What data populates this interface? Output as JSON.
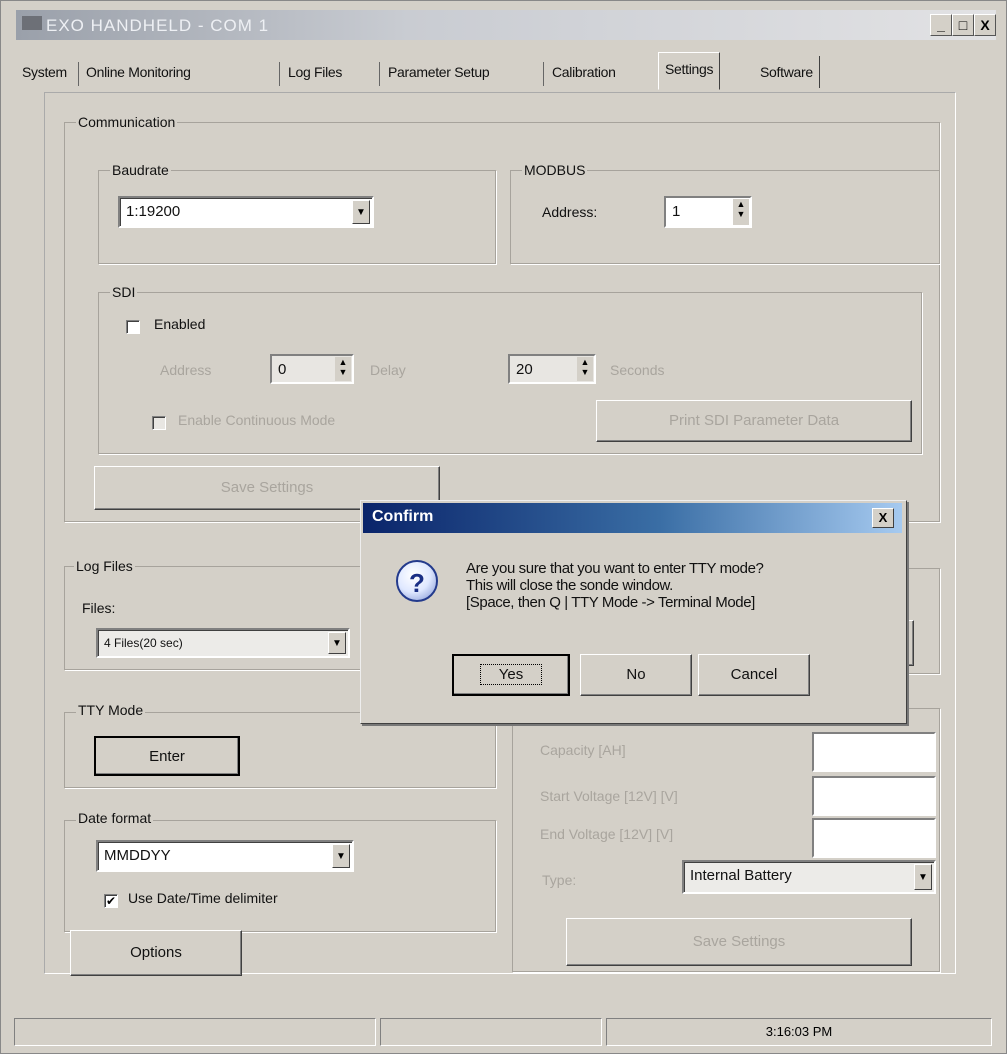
{
  "window": {
    "title": "EXO HANDHELD - COM 1",
    "minimize": "_",
    "maximize": "□",
    "close": "X"
  },
  "tabs": [
    "System",
    "Online Monitoring",
    "Log Files",
    "Parameter Setup",
    "Calibration",
    "Settings",
    "Software"
  ],
  "communication": {
    "label": "Communication",
    "baudrate": {
      "label": "Baudrate",
      "value": "1:19200"
    },
    "modbus": {
      "label": "MODBUS",
      "address_label": "Address:",
      "address_value": "1"
    },
    "sdi": {
      "label": "SDI",
      "enabled_label": "Enabled",
      "address_label": "Address",
      "address_value": "0",
      "delay_label": "Delay",
      "delay_value": "20",
      "seconds_label": "Seconds",
      "continuous_label": "Enable Continuous Mode",
      "print_button": "Print SDI Parameter Data"
    },
    "save_button": "Save Settings"
  },
  "log_files": {
    "label": "Log Files",
    "files_label": "Files:",
    "files_value": "4 Files(20 sec)"
  },
  "tty_mode": {
    "label": "TTY Mode",
    "enter_button": "Enter"
  },
  "date_format": {
    "label": "Date format",
    "value": "MMDDYY",
    "delimiter_label": "Use Date/Time delimiter"
  },
  "options_button": "Options",
  "battery": {
    "capacity_label": "Capacity [AH]",
    "start_voltage_label": "Start Voltage [12V] [V]",
    "end_voltage_label": "End Voltage [12V] [V]",
    "type_label": "Type:",
    "type_value": "Internal Battery",
    "save_button": "Save Settings"
  },
  "dialog": {
    "title": "Confirm",
    "close": "X",
    "icon": "question-icon",
    "message_line1": "Are you sure that you want to enter TTY mode?",
    "message_line2": "This will close the sonde window.",
    "message_line3": "[Space, then Q | TTY Mode -> Terminal Mode]",
    "yes_button": "Yes",
    "no_button": "No",
    "cancel_button": "Cancel"
  },
  "status_bar": {
    "time": "3:16:03 PM"
  }
}
